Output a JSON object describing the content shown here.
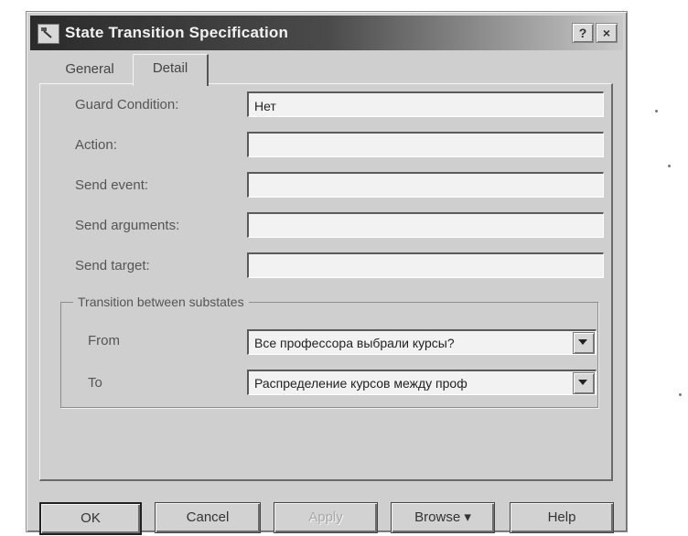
{
  "window": {
    "title": "State Transition Specification",
    "help_button": "?",
    "close_button": "×"
  },
  "tabs": [
    {
      "label": "General",
      "active": false
    },
    {
      "label": "Detail",
      "active": true
    }
  ],
  "fields": {
    "guard_condition": {
      "label": "Guard Condition:",
      "value": "Нет"
    },
    "action": {
      "label": "Action:",
      "value": ""
    },
    "send_event": {
      "label": "Send event:",
      "value": ""
    },
    "send_arguments": {
      "label": "Send arguments:",
      "value": ""
    },
    "send_target": {
      "label": "Send target:",
      "value": ""
    }
  },
  "substates": {
    "group_title": "Transition between substates",
    "from": {
      "label": "From",
      "value": "Все профессора выбрали курсы?"
    },
    "to": {
      "label": "To",
      "value": "Распределение курсов между проф"
    }
  },
  "buttons": {
    "ok": "OK",
    "cancel": "Cancel",
    "apply": "Apply",
    "browse": "Browse ▾",
    "help": "Help"
  },
  "colors": {
    "dialog_bg": "#cfcfcf",
    "titlebar": "#2b2b2b",
    "input_bg": "#f2f2f2"
  }
}
